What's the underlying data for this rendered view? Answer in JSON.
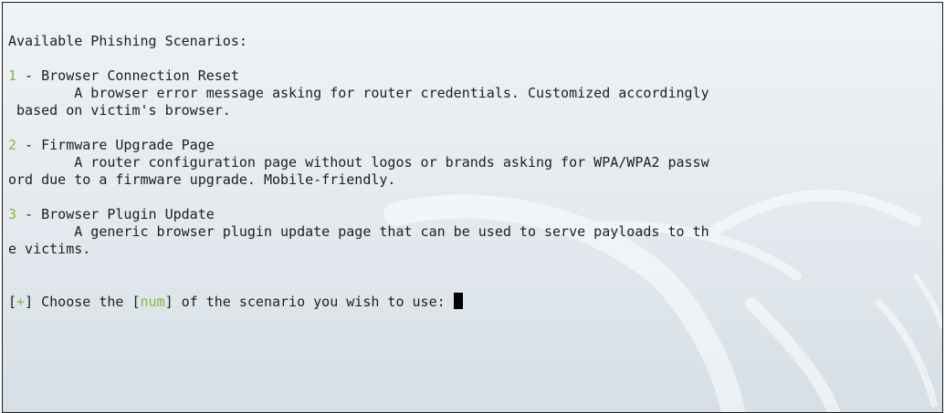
{
  "terminal": {
    "heading": "Available Phishing Scenarios:",
    "scenarios": [
      {
        "num": "1",
        "title": " - Browser Connection Reset",
        "desc_line1": "        A browser error message asking for router credentials. Customized accordingly",
        "desc_line2": " based on victim's browser."
      },
      {
        "num": "2",
        "title": " - Firmware Upgrade Page",
        "desc_line1": "        A router configuration page without logos or brands asking for WPA/WPA2 passw",
        "desc_line2": "ord due to a firmware upgrade. Mobile-friendly."
      },
      {
        "num": "3",
        "title": " - Browser Plugin Update",
        "desc_line1": "        A generic browser plugin update page that can be used to serve payloads to th",
        "desc_line2": "e victims."
      }
    ],
    "prompt": {
      "open_bracket": "[",
      "plus": "+",
      "mid1": "] Choose the [",
      "num": "num",
      "mid2": "] of the scenario you wish to use: "
    }
  },
  "colors": {
    "accent_green": "#86b83e",
    "text": "#1e1e1e",
    "background": "#e3e9ee"
  },
  "icons": {
    "watermark": "kali-dragon-icon",
    "cursor": "block-cursor"
  }
}
